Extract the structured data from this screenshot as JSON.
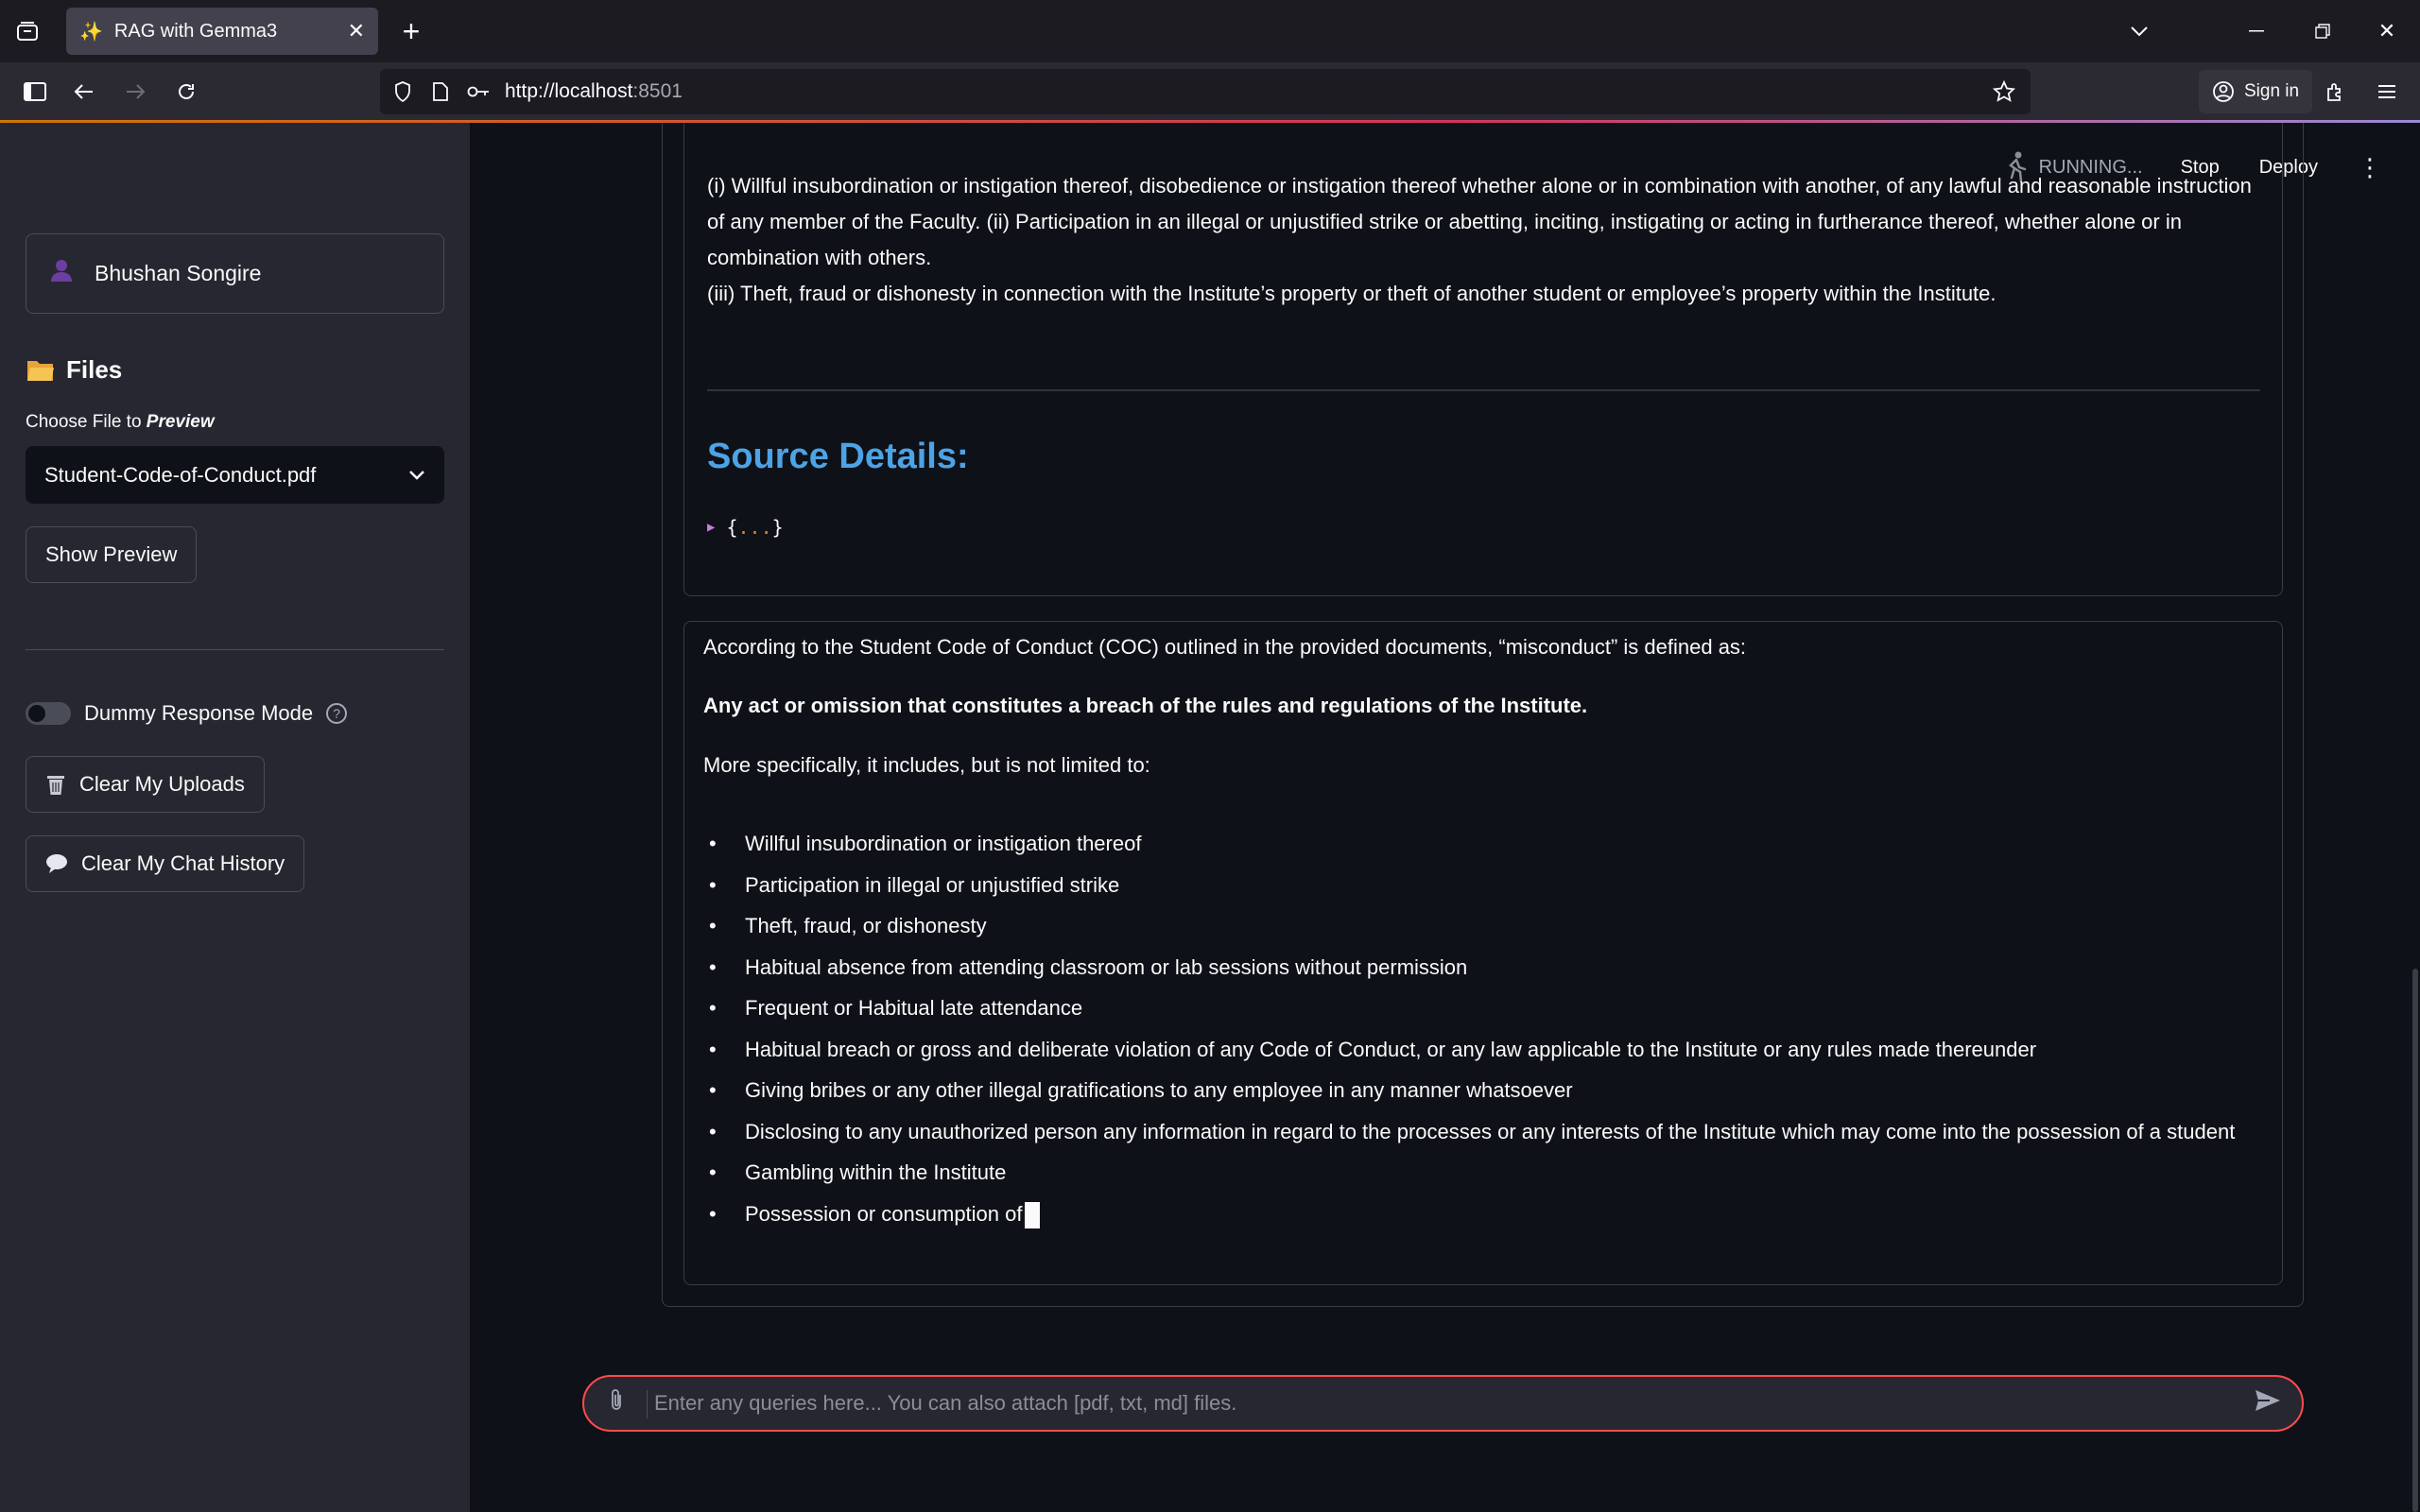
{
  "browser": {
    "tab_title": "RAG with Gemma3",
    "tab_emoji": "✨",
    "url_host": "http://localhost",
    "url_port": ":8501",
    "signin_label": "Sign in"
  },
  "app_header": {
    "running_label": "RUNNING...",
    "stop_label": "Stop",
    "deploy_label": "Deploy"
  },
  "sidebar": {
    "user_name": "Bhushan Songire",
    "files_title": "Files",
    "choose_label_prefix": "Choose File to ",
    "choose_label_emph": "Preview",
    "selected_file": "Student-Code-of-Conduct.pdf",
    "show_preview_label": "Show Preview",
    "dummy_mode_label": "Dummy Response Mode",
    "dummy_mode_on": false,
    "clear_uploads_label": "Clear My Uploads",
    "clear_history_label": "Clear My Chat History"
  },
  "context_card": {
    "text_line1": "(i) Willful insubordination or instigation thereof, disobedience or instigation thereof whether alone or in combination with another, of any lawful and reasonable instruction of any member of the Faculty. (ii) Participation in an illegal or unjustified strike or abetting, inciting, instigating or acting in furtherance thereof, whether alone or in combination with others.",
    "text_line2": "(iii) Theft, fraud or dishonesty in connection with the Institute’s property or theft of another student or employee’s property within the Institute.",
    "source_title": "Source Details:",
    "json_open": "{",
    "json_dots": "...",
    "json_close": "}"
  },
  "answer_card": {
    "intro": "According to the Student Code of Conduct (COC) outlined in the provided documents, “misconduct” is defined as:",
    "bold_definition": "Any act or omission that constitutes a breach of the rules and regulations of the Institute.",
    "lead": "More specifically, it includes, but is not limited to:",
    "items": [
      "Willful insubordination or instigation thereof",
      "Participation in illegal or unjustified strike",
      "Theft, fraud, or dishonesty",
      "Habitual absence from attending classroom or lab sessions without permission",
      "Frequent or Habitual late attendance",
      "Habitual breach or gross and deliberate violation of any Code of Conduct, or any law applicable to the Institute or any rules made thereunder",
      "Giving bribes or any other illegal gratifications to any employee in any manner whatsoever",
      "Disclosing to any unauthorized person any information in regard to the processes or any interests of the Institute which may come into the possession of a student",
      "Gambling within the Institute",
      "Possession or consumption of"
    ]
  },
  "chat_input": {
    "placeholder": "Enter any queries here... You can also attach [pdf, txt, md] files.",
    "value": ""
  },
  "colors": {
    "accent_red": "#ff4b4b",
    "source_title_blue": "#4ca3e6",
    "sidebar_bg": "#262730",
    "main_bg": "#0e1117"
  }
}
